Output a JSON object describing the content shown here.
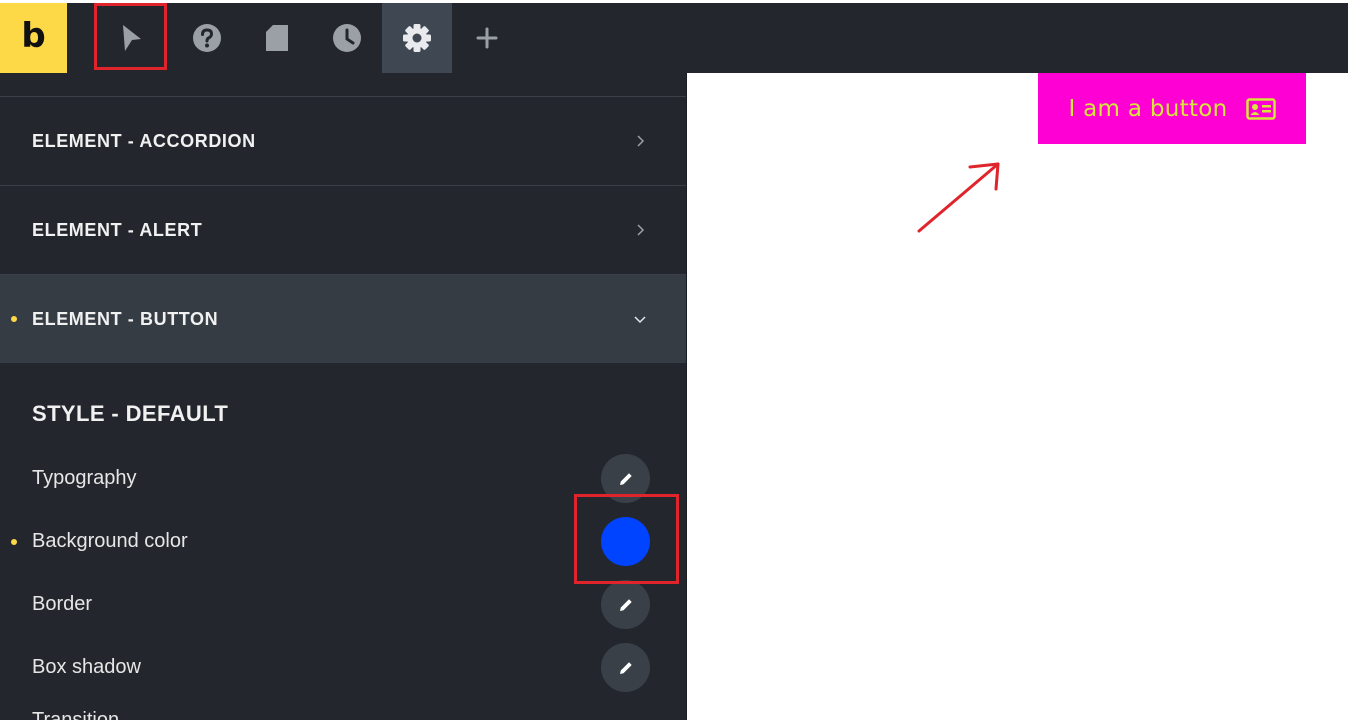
{
  "toolbar": {
    "logo_text": "b",
    "buttons": [
      {
        "name": "select-element",
        "icon": "cursor-icon"
      },
      {
        "name": "help",
        "icon": "help-circle-icon"
      },
      {
        "name": "pages",
        "icon": "page-icon"
      },
      {
        "name": "revisions",
        "icon": "clock-icon"
      },
      {
        "name": "settings",
        "icon": "gear-icon",
        "active": true
      },
      {
        "name": "add",
        "icon": "plus-icon"
      }
    ]
  },
  "panel": {
    "sections": [
      {
        "label": "ELEMENT - ACCORDION",
        "expanded": false,
        "modified": false
      },
      {
        "label": "ELEMENT - ALERT",
        "expanded": false,
        "modified": false
      },
      {
        "label": "ELEMENT - BUTTON",
        "expanded": true,
        "modified": true
      }
    ],
    "group_title": "STYLE - DEFAULT",
    "controls": [
      {
        "label": "Typography",
        "type": "edit",
        "icon": "pencil-icon",
        "modified": false
      },
      {
        "label": "Background color",
        "type": "color",
        "color": "#0044ff",
        "modified": true
      },
      {
        "label": "Border",
        "type": "edit",
        "icon": "pencil-icon",
        "modified": false
      },
      {
        "label": "Box shadow",
        "type": "edit",
        "icon": "pencil-icon",
        "modified": false
      },
      {
        "label": "Transition",
        "type": "edit",
        "modified": false
      }
    ]
  },
  "canvas": {
    "button": {
      "label": "I am a button",
      "icon": "id-card-icon",
      "background": "#ff00d4",
      "text_color": "#d4e83a"
    }
  },
  "colors": {
    "accent": "#fdd847",
    "annotation": "#e0242b",
    "panel_bg": "#23272d"
  }
}
